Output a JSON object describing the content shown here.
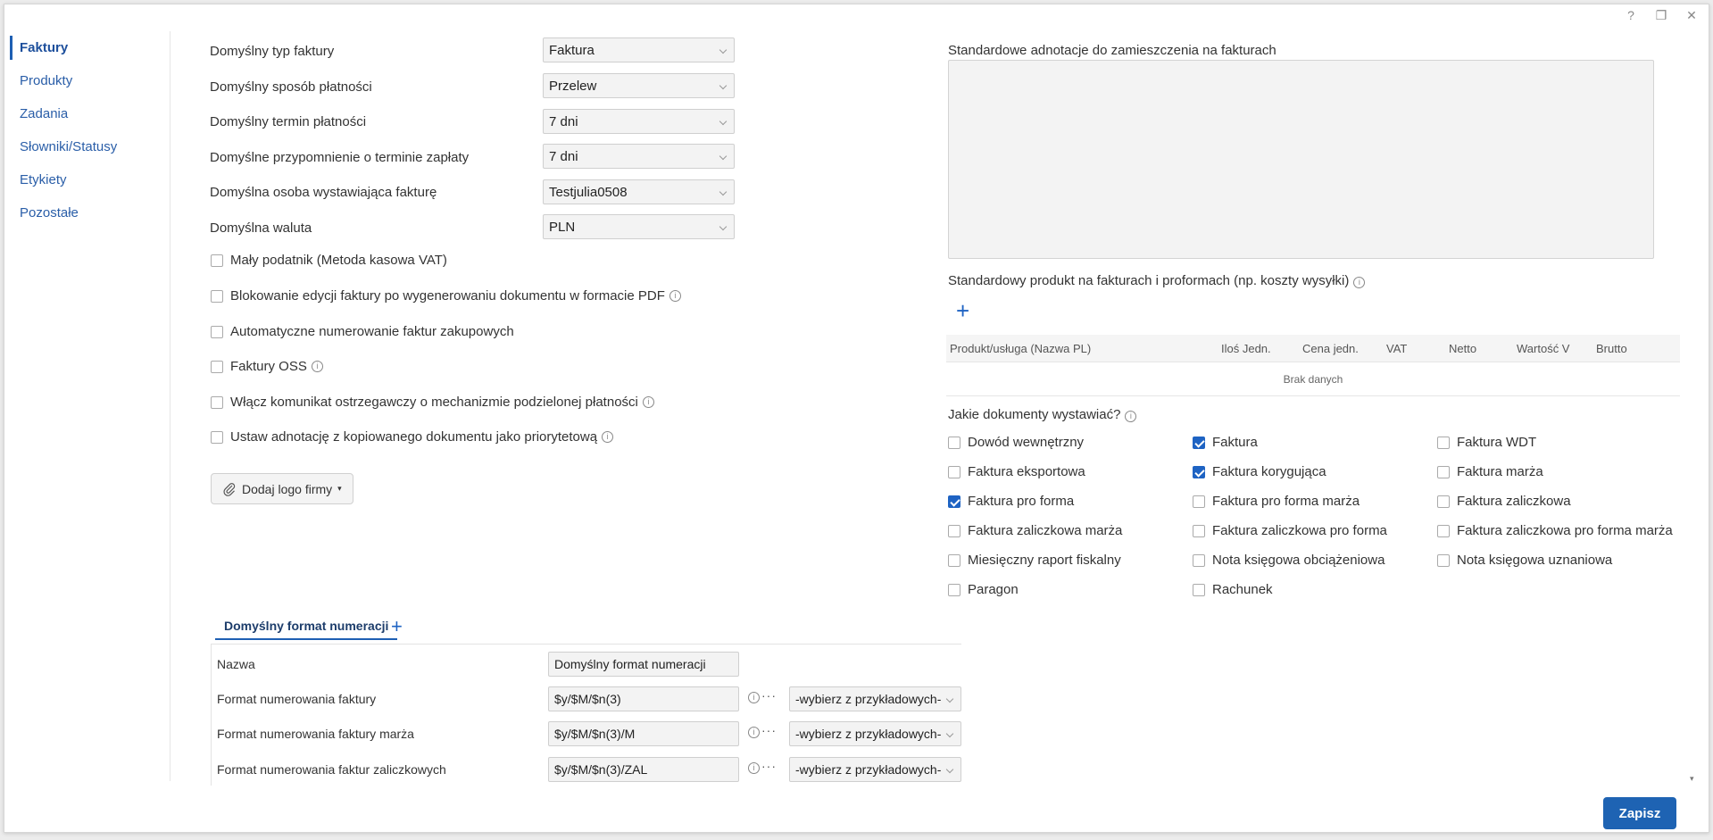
{
  "window": {
    "help_icon": "?",
    "restore_icon": "❐",
    "close_icon": "✕"
  },
  "sidebar": {
    "items": [
      "Faktury",
      "Produkty",
      "Zadania",
      "Słowniki/Statusy",
      "Etykiety",
      "Pozostałe"
    ]
  },
  "defaults": [
    {
      "label": "Domyślny typ faktury",
      "value": "Faktura"
    },
    {
      "label": "Domyślny sposób płatności",
      "value": "Przelew"
    },
    {
      "label": "Domyślny termin płatności",
      "value": "7 dni"
    },
    {
      "label": "Domyślne przypomnienie o terminie zapłaty",
      "value": "7 dni"
    },
    {
      "label": "Domyślna osoba wystawiająca fakturę",
      "value": "Testjulia0508"
    },
    {
      "label": "Domyślna waluta",
      "value": "PLN"
    }
  ],
  "options": [
    {
      "label": "Mały podatnik (Metoda kasowa VAT)",
      "checked": false,
      "info": false
    },
    {
      "label": "Blokowanie edycji faktury po wygenerowaniu dokumentu w formacie PDF",
      "checked": false,
      "info": true
    },
    {
      "label": "Automatyczne numerowanie faktur zakupowych",
      "checked": false,
      "info": false
    },
    {
      "label": "Faktury OSS",
      "checked": false,
      "info": true
    },
    {
      "label": "Włącz komunikat ostrzegawczy o mechanizmie podzielonej płatności",
      "checked": false,
      "info": true
    },
    {
      "label": "Ustaw adnotację z kopiowanego dokumentu jako priorytetową",
      "checked": false,
      "info": true
    }
  ],
  "logo_button": "Dodaj logo firmy",
  "annotations": {
    "label": "Standardowe adnotacje do zamieszczenia na fakturach",
    "value": ""
  },
  "standard_product": {
    "label": "Standardowy produkt na fakturach i proformach (np. koszty wysyłki)",
    "columns": [
      "Produkt/usługa (Nazwa PL)",
      "Iloś Jedn.",
      "Cena jedn.",
      "VAT",
      "Netto",
      "Wartość V",
      "Brutto"
    ],
    "empty_text": "Brak danych"
  },
  "documents": {
    "label": "Jakie dokumenty wystawiać?",
    "items": [
      {
        "label": "Dowód wewnętrzny",
        "checked": false
      },
      {
        "label": "Faktura",
        "checked": true
      },
      {
        "label": "Faktura WDT",
        "checked": false
      },
      {
        "label": "Faktura eksportowa",
        "checked": false
      },
      {
        "label": "Faktura korygująca",
        "checked": true
      },
      {
        "label": "Faktura marża",
        "checked": false
      },
      {
        "label": "Faktura pro forma",
        "checked": true
      },
      {
        "label": "Faktura pro forma marża",
        "checked": false
      },
      {
        "label": "Faktura zaliczkowa",
        "checked": false
      },
      {
        "label": "Faktura zaliczkowa marża",
        "checked": false
      },
      {
        "label": "Faktura zaliczkowa pro forma",
        "checked": false
      },
      {
        "label": "Faktura zaliczkowa pro forma marża",
        "checked": false
      },
      {
        "label": "Miesięczny raport fiskalny",
        "checked": false
      },
      {
        "label": "Nota księgowa obciążeniowa",
        "checked": false
      },
      {
        "label": "Nota księgowa uznaniowa",
        "checked": false
      },
      {
        "label": "Paragon",
        "checked": false
      },
      {
        "label": "Rachunek",
        "checked": false
      }
    ]
  },
  "numbering": {
    "tab_label": "Domyślny format numeracji",
    "name_label": "Nazwa",
    "name_value": "Domyślny format numeracji",
    "formats": [
      {
        "label": "Format numerowania faktury",
        "value": "$y/$M/$n(3)",
        "select": "-wybierz z przykładowych-"
      },
      {
        "label": "Format numerowania faktury marża",
        "value": "$y/$M/$n(3)/M",
        "select": "-wybierz z przykładowych-"
      },
      {
        "label": "Format numerowania faktur zaliczkowych",
        "value": "$y/$M/$n(3)/ZAL",
        "select": "-wybierz z przykładowych-"
      }
    ]
  },
  "save_button": "Zapisz",
  "colors": {
    "accent": "#1e63b3",
    "link": "#2a5ea8"
  }
}
